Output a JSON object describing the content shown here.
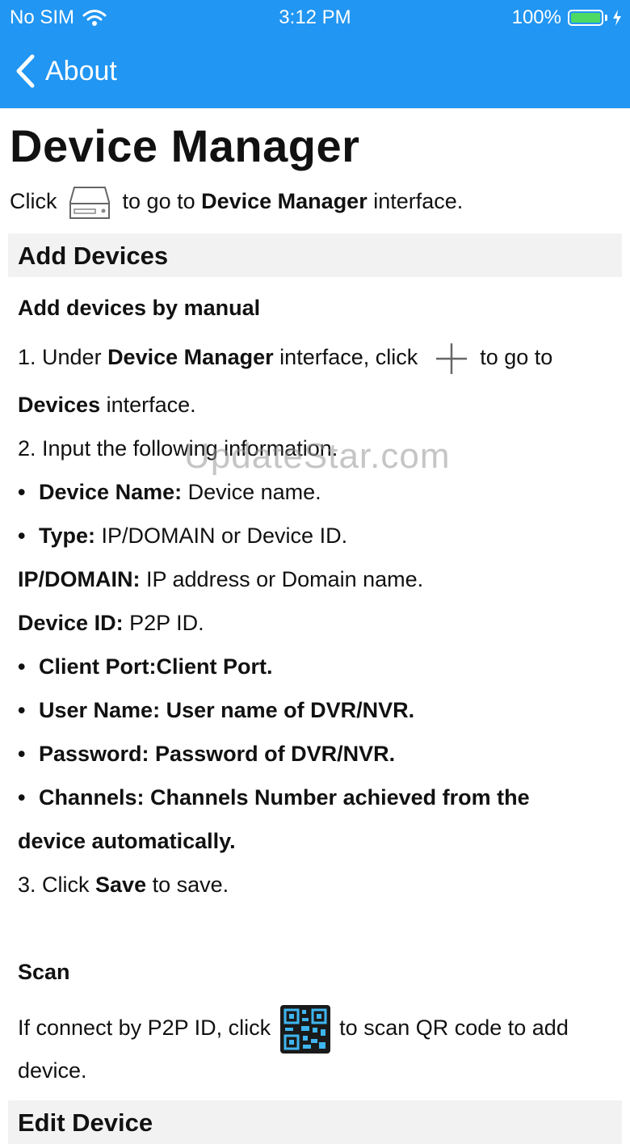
{
  "status": {
    "carrier": "No SIM",
    "time": "3:12 PM",
    "battery": "100%"
  },
  "nav": {
    "back_label": "About"
  },
  "page": {
    "title": "Device Manager"
  },
  "intro": {
    "t1": "Click",
    "t2": " to go to ",
    "bold": "Device Manager",
    "t3": " interface."
  },
  "section_add": {
    "title": "Add Devices"
  },
  "manual": {
    "heading": "Add devices by manual",
    "step1_a": "1. Under ",
    "step1_bold": "Device Manager",
    "step1_b": " interface, click",
    "step1_c": " to go to",
    "step1_line2_bold": "Devices",
    "step1_line2": " interface.",
    "step2": "2. Input the following information.",
    "item_name_label": "Device Name:",
    "item_name_text": " Device name.",
    "item_type_label": "Type:",
    "item_type_text": " IP/DOMAIN or Device ID.",
    "ipdomain_label": "IP/DOMAIN:",
    "ipdomain_text": " IP address or Domain name.",
    "deviceid_label": "Device ID:",
    "deviceid_text": " P2P ID.",
    "client_port": "Client Port:Client Port.",
    "user_name": "User Name: User name of DVR/NVR.",
    "password": "Password: Password of DVR/NVR.",
    "channels_1": "Channels: Channels Number achieved from the",
    "channels_2": "device automatically.",
    "step3_a": "3. Click ",
    "step3_bold": "Save",
    "step3_b": " to save."
  },
  "scan": {
    "heading": "Scan",
    "text_a": "If connect by P2P ID, click",
    "text_b": " to scan QR code to add",
    "text_c": "device."
  },
  "section_edit": {
    "title": "Edit Device"
  },
  "watermark": "UpdateStar.com",
  "colors": {
    "nav_bg": "#2196f3",
    "section_bg": "#f2f2f2",
    "battery": "#4cd964"
  }
}
